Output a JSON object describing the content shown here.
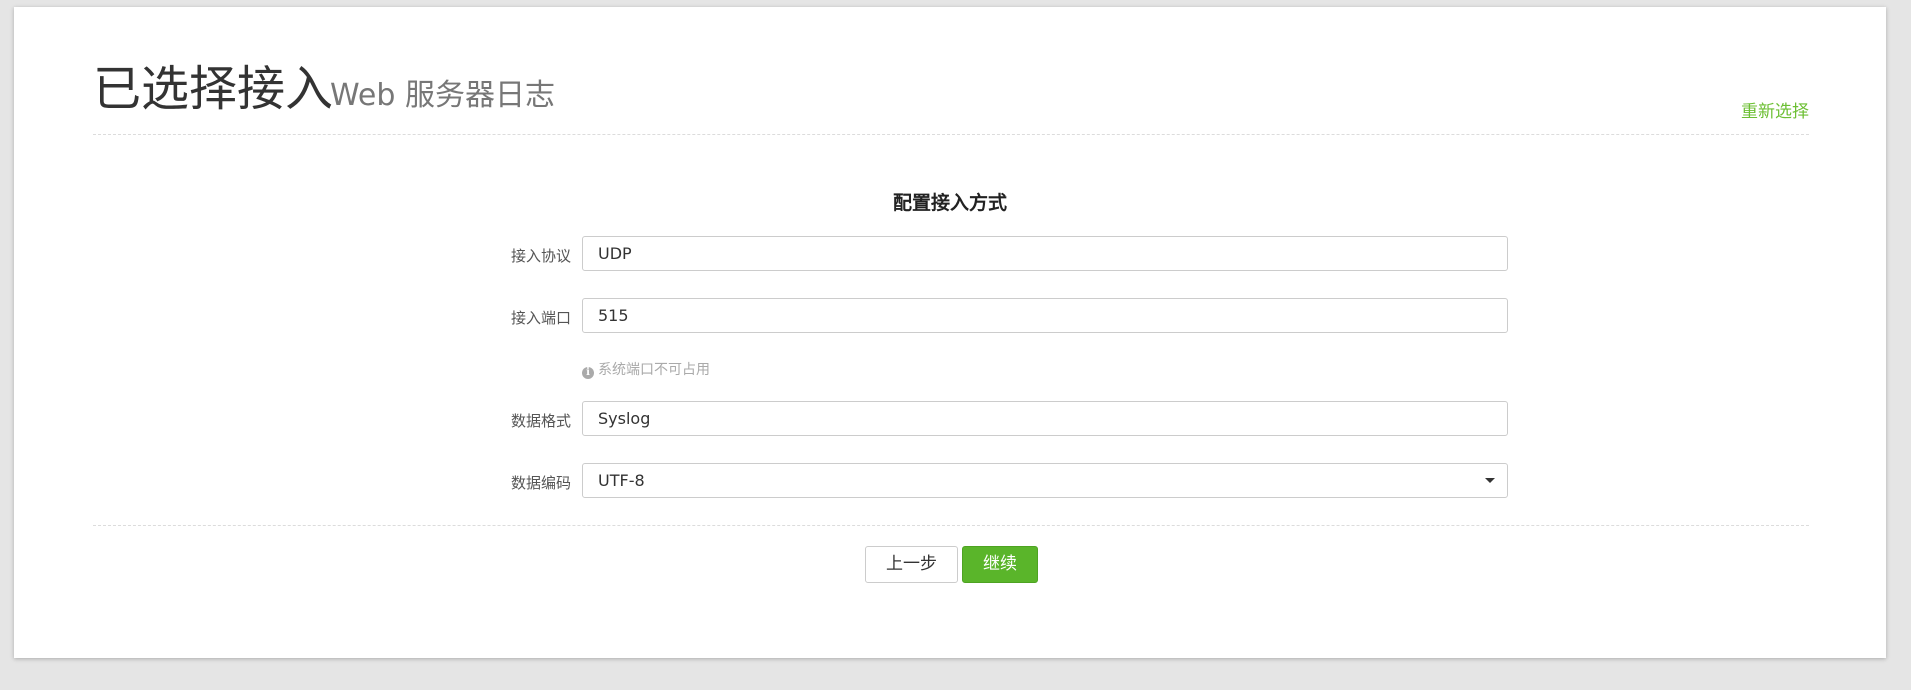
{
  "header": {
    "title": "已选择接入",
    "subtitle": "Web 服务器日志",
    "reselect_label": "重新选择"
  },
  "form": {
    "section_title": "配置接入方式",
    "protocol": {
      "label": "接入协议",
      "value": "UDP"
    },
    "port": {
      "label": "接入端口",
      "value": "515",
      "hint": "系统端口不可占用"
    },
    "data_format": {
      "label": "数据格式",
      "value": "Syslog"
    },
    "encoding": {
      "label": "数据编码",
      "value": "UTF-8"
    }
  },
  "actions": {
    "prev_label": "上一步",
    "next_label": "继续"
  },
  "icons": {
    "info": "info-circle-icon",
    "dropdown": "caret-down-icon"
  },
  "colors": {
    "accent": "#6cbf33",
    "primary_button": "#5ab52a"
  }
}
